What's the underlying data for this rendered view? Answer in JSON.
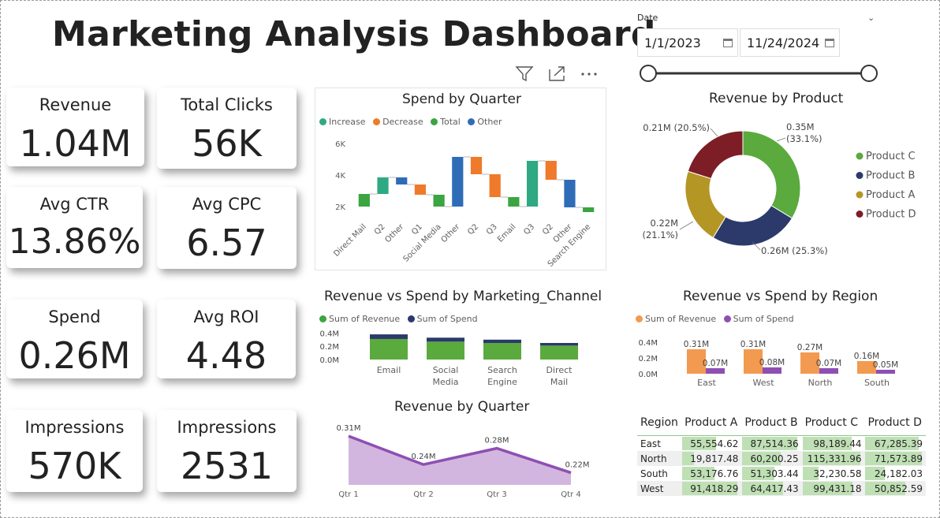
{
  "title": "Marketing Analysis Dashboard",
  "kpis": [
    {
      "label": "Revenue",
      "value": "1.04M"
    },
    {
      "label": "Total Clicks",
      "value": "56K"
    },
    {
      "label": "Avg CTR",
      "value": "13.86%"
    },
    {
      "label": "Avg CPC",
      "value": "6.57"
    },
    {
      "label": "Spend",
      "value": "0.26M"
    },
    {
      "label": "Avg ROI",
      "value": "4.48"
    },
    {
      "label": "Impressions",
      "value": "570K"
    },
    {
      "label": "Impressions",
      "value": "2531"
    }
  ],
  "date_filter": {
    "label": "Date",
    "start": "1/1/2023",
    "end": "11/24/2024",
    "slider_start": 0,
    "slider_end": 1
  },
  "colors": {
    "increase": "#2fa982",
    "decrease": "#ef7a2a",
    "total": "#3aa541",
    "other": "#2f6cb8",
    "green": "#5aaa3e",
    "navy": "#2b3a6b",
    "olive": "#b49625",
    "maroon": "#7d1d26",
    "orange": "#f29a4f",
    "purple": "#8e4fb2",
    "area": "#d3b6df",
    "line": "#8e4fb2"
  },
  "chart_data": [
    {
      "id": "spend_by_quarter",
      "type": "waterfall",
      "title": "Spend by Quarter",
      "legend": [
        "Increase",
        "Decrease",
        "Total",
        "Other"
      ],
      "y_ticks": [
        "6K",
        "4K",
        "2K"
      ],
      "ylim": [
        1000,
        6600
      ],
      "categories": [
        "Direct Mail",
        "Q2",
        "Other",
        "Q1",
        "Social Media",
        "Other",
        "Q2",
        "Q3",
        "Email",
        "Q3",
        "Q2",
        "Other",
        "Search Engine"
      ],
      "bars": [
        {
          "start": 2000,
          "end": 2800,
          "kind": "total"
        },
        {
          "start": 2800,
          "end": 3850,
          "kind": "increase"
        },
        {
          "start": 3850,
          "end": 3400,
          "kind": "other"
        },
        {
          "start": 3400,
          "end": 2750,
          "kind": "decrease"
        },
        {
          "start": 2750,
          "end": 2000,
          "kind": "total"
        },
        {
          "start": 2000,
          "end": 5150,
          "kind": "other"
        },
        {
          "start": 5150,
          "end": 4050,
          "kind": "decrease"
        },
        {
          "start": 4050,
          "end": 2600,
          "kind": "decrease"
        },
        {
          "start": 2600,
          "end": 2000,
          "kind": "total"
        },
        {
          "start": 2000,
          "end": 4900,
          "kind": "increase"
        },
        {
          "start": 4900,
          "end": 3700,
          "kind": "decrease"
        },
        {
          "start": 3700,
          "end": 1950,
          "kind": "other"
        },
        {
          "start": 1950,
          "end": 1650,
          "kind": "total"
        }
      ]
    },
    {
      "id": "revenue_by_product",
      "type": "donut",
      "title": "Revenue by Product",
      "slices": [
        {
          "name": "Product C",
          "value": 0.35,
          "value_label": "0.35M",
          "pct_label": "(33.1%)",
          "color": "#5aaa3e"
        },
        {
          "name": "Product B",
          "value": 0.26,
          "value_label": "0.26M",
          "pct_label": "(25.3%)",
          "color": "#2b3a6b"
        },
        {
          "name": "Product A",
          "value": 0.22,
          "value_label": "0.22M",
          "pct_label": "(21.1%)",
          "color": "#b49625"
        },
        {
          "name": "Product D",
          "value": 0.21,
          "value_label": "0.21M",
          "pct_label": "(20.5%)",
          "color": "#7d1d26"
        }
      ],
      "slice_labels": [
        "0.35M (33.1%)",
        "0.26M (25.3%)",
        "0.22M (21.1%)",
        "0.21M (20.5%)"
      ]
    },
    {
      "id": "rev_spend_channel",
      "type": "stacked_bar",
      "title": "Revenue vs Spend by Marketing_Channel",
      "legend": [
        "Sum of Revenue",
        "Sum of Spend"
      ],
      "y_ticks": [
        "0.4M",
        "0.2M",
        "0.0M"
      ],
      "ylim": [
        0,
        0.5
      ],
      "categories": [
        "Email",
        "Social Media",
        "Search Engine",
        "Direct Mail"
      ],
      "series": [
        {
          "name": "Sum of Revenue",
          "values": [
            0.31,
            0.27,
            0.25,
            0.21
          ]
        },
        {
          "name": "Sum of Spend",
          "values": [
            0.07,
            0.06,
            0.05,
            0.04
          ]
        }
      ]
    },
    {
      "id": "rev_spend_region",
      "type": "bar",
      "title": "Revenue vs Spend by Region",
      "legend": [
        "Sum of Revenue",
        "Sum of Spend"
      ],
      "y_ticks": [
        "0.4M",
        "0.2M",
        "0.0M"
      ],
      "ylim": [
        0,
        0.4
      ],
      "categories": [
        "East",
        "West",
        "North",
        "South"
      ],
      "series": [
        {
          "name": "Sum of Revenue",
          "values": [
            0.31,
            0.31,
            0.27,
            0.16
          ],
          "labels": [
            "0.31M",
            "0.31M",
            "0.27M",
            "0.16M"
          ]
        },
        {
          "name": "Sum of Spend",
          "values": [
            0.07,
            0.08,
            0.07,
            0.05
          ],
          "labels": [
            "0.07M",
            "0.08M",
            "0.07M",
            "0.05M"
          ]
        }
      ]
    },
    {
      "id": "revenue_by_quarter",
      "type": "area",
      "title": "Revenue by Quarter",
      "categories": [
        "Qtr 1",
        "Qtr 2",
        "Qtr 3",
        "Qtr 4"
      ],
      "values": [
        0.31,
        0.24,
        0.28,
        0.22
      ],
      "labels": [
        "0.31M",
        "0.24M",
        "0.28M",
        "0.22M"
      ],
      "ylim": [
        0.19,
        0.32
      ]
    }
  ],
  "table": {
    "headers": [
      "Region",
      "Product A",
      "Product B",
      "Product C",
      "Product D"
    ],
    "rows": [
      {
        "region": "East",
        "values": [
          "55,554.62",
          "87,514.36",
          "98,189.44",
          "67,285.39"
        ],
        "nums": [
          55554.62,
          87514.36,
          98189.44,
          67285.39
        ]
      },
      {
        "region": "North",
        "values": [
          "19,817.48",
          "60,200.25",
          "115,331.96",
          "71,573.89"
        ],
        "nums": [
          19817.48,
          60200.25,
          115331.96,
          71573.89
        ]
      },
      {
        "region": "South",
        "values": [
          "53,176.76",
          "51,303.44",
          "32,230.58",
          "24,182.03"
        ],
        "nums": [
          53176.76,
          51303.44,
          32230.58,
          24182.03
        ]
      },
      {
        "region": "West",
        "values": [
          "91,418.29",
          "64,417.43",
          "99,431.18",
          "50,852.59"
        ],
        "nums": [
          91418.29,
          64417.43,
          99431.18,
          50852.59
        ]
      }
    ]
  }
}
